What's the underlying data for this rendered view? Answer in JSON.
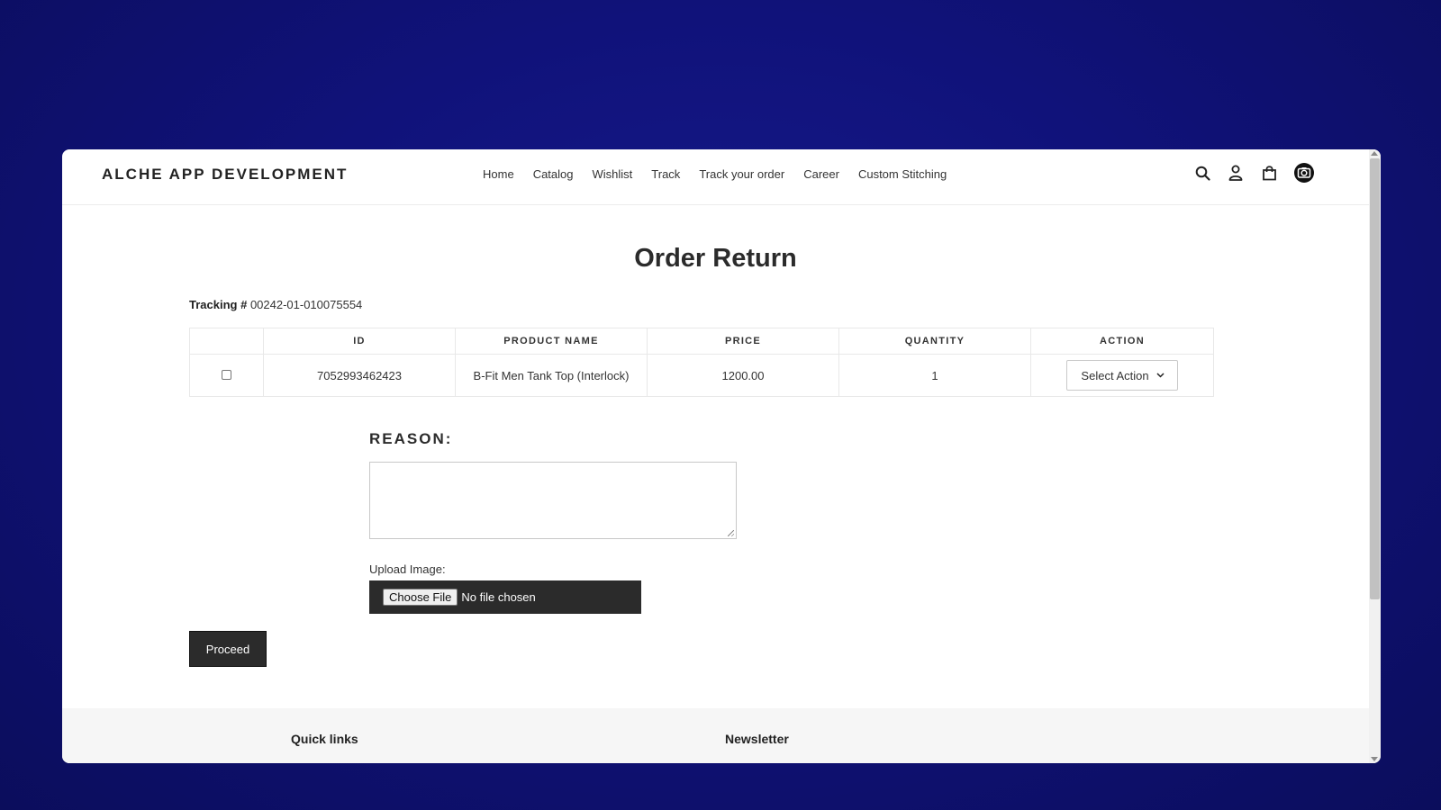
{
  "header": {
    "logo": "ALCHE APP DEVELOPMENT",
    "nav": [
      "Home",
      "Catalog",
      "Wishlist",
      "Track",
      "Track your order",
      "Career",
      "Custom Stitching"
    ],
    "icons": [
      "search-icon",
      "account-icon",
      "cart-icon",
      "camera-icon"
    ]
  },
  "page": {
    "title": "Order Return",
    "tracking_label": "Tracking #",
    "tracking_number": "00242-01-010075554"
  },
  "table": {
    "headers": [
      "",
      "ID",
      "PRODUCT NAME",
      "PRICE",
      "QUANTITY",
      "ACTION"
    ],
    "rows": [
      {
        "checked": false,
        "id": "7052993462423",
        "product_name": "B-Fit Men Tank Top (Interlock)",
        "price": "1200.00",
        "quantity": "1",
        "action": "Select Action"
      }
    ]
  },
  "form": {
    "reason_label": "REASON:",
    "reason_value": "",
    "upload_label": "Upload Image:",
    "choose_file": "Choose File",
    "no_file": "No file chosen",
    "proceed": "Proceed"
  },
  "footer": {
    "quick_links": "Quick links",
    "newsletter": "Newsletter"
  },
  "colors": {
    "background": "#10127a",
    "dark_button": "#2b2b2b",
    "text": "#333333"
  }
}
